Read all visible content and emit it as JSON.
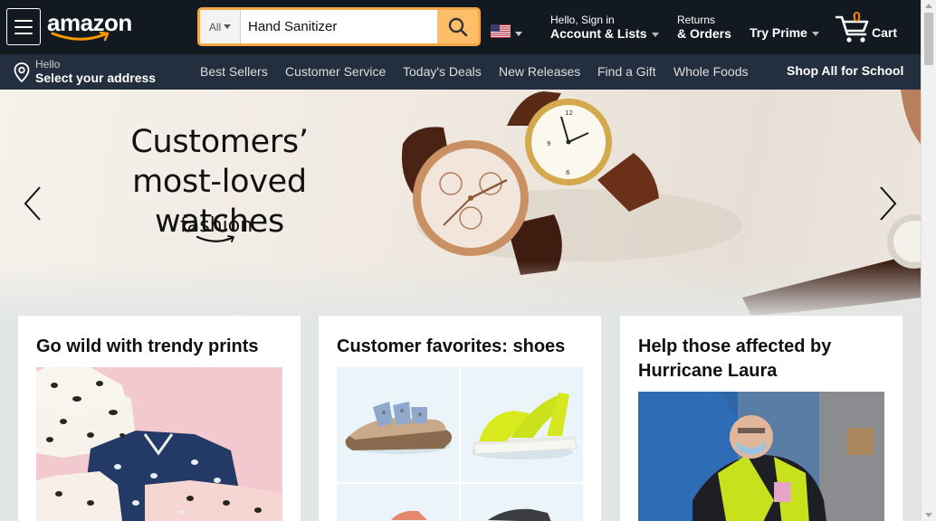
{
  "header": {
    "logo_text": "amazon",
    "search": {
      "category": "All",
      "value": "Hand Sanitizer",
      "placeholder": ""
    },
    "account": {
      "line1": "Hello, Sign in",
      "line2": "Account & Lists"
    },
    "orders": {
      "line1": "Returns",
      "line2": "& Orders"
    },
    "prime": "Try Prime",
    "cart": {
      "count": "0",
      "label": "Cart"
    }
  },
  "subnav": {
    "address": {
      "line1": "Hello",
      "line2": "Select your address"
    },
    "links": [
      "Best Sellers",
      "Customer Service",
      "Today's Deals",
      "New Releases",
      "Find a Gift",
      "Whole Foods"
    ],
    "promo": "Shop All for School"
  },
  "hero": {
    "title_line1": "Customers’",
    "title_line2": "most-loved watches",
    "brand": "fashion"
  },
  "cards": [
    {
      "title": "Go wild with trendy prints"
    },
    {
      "title": "Customer favorites: shoes"
    },
    {
      "title": "Help those affected by Hurricane Laura"
    }
  ],
  "colors": {
    "nav_dark": "#131921",
    "nav_secondary": "#232f3e",
    "accent_orange": "#febd69",
    "search_border": "#f3a847",
    "cart_count": "#f08804"
  }
}
